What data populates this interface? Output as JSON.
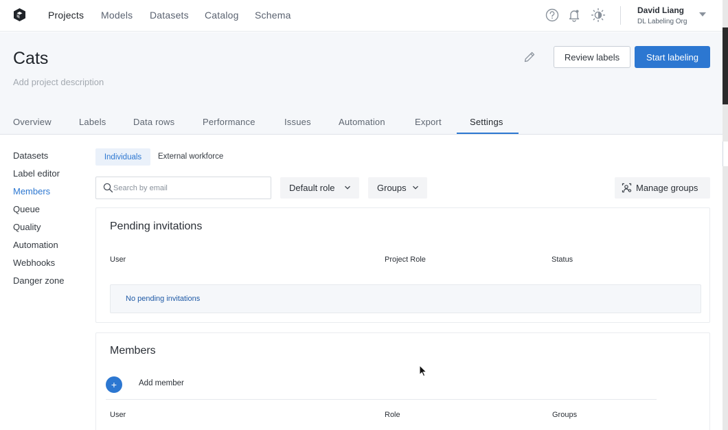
{
  "nav": {
    "links": [
      "Projects",
      "Models",
      "Datasets",
      "Catalog",
      "Schema"
    ],
    "active": "Projects"
  },
  "user": {
    "name": "David Liang",
    "org": "DL Labeling Org"
  },
  "project": {
    "title": "Cats",
    "description_placeholder": "Add project description",
    "review_button": "Review labels",
    "start_button": "Start labeling"
  },
  "tabs": [
    "Overview",
    "Labels",
    "Data rows",
    "Performance",
    "Issues",
    "Automation",
    "Export",
    "Settings"
  ],
  "active_tab": "Settings",
  "sidebar": {
    "items": [
      "Datasets",
      "Label editor",
      "Members",
      "Queue",
      "Quality",
      "Automation",
      "Webhooks",
      "Danger zone"
    ],
    "active": "Members"
  },
  "subtabs": {
    "individuals": "Individuals",
    "external": "External workforce"
  },
  "toolbar": {
    "search_placeholder": "Search by email",
    "default_role": "Default role",
    "groups": "Groups",
    "manage_groups": "Manage groups"
  },
  "pending": {
    "title": "Pending invitations",
    "columns": [
      "User",
      "Project Role",
      "Status"
    ],
    "empty": "No pending invitations"
  },
  "members": {
    "title": "Members",
    "add_icon": "+",
    "add_label": "Add member",
    "columns": [
      "User",
      "Role",
      "Groups"
    ]
  },
  "colors": {
    "accent": "#2c77d1",
    "header_bg": "#f5f7fa"
  }
}
